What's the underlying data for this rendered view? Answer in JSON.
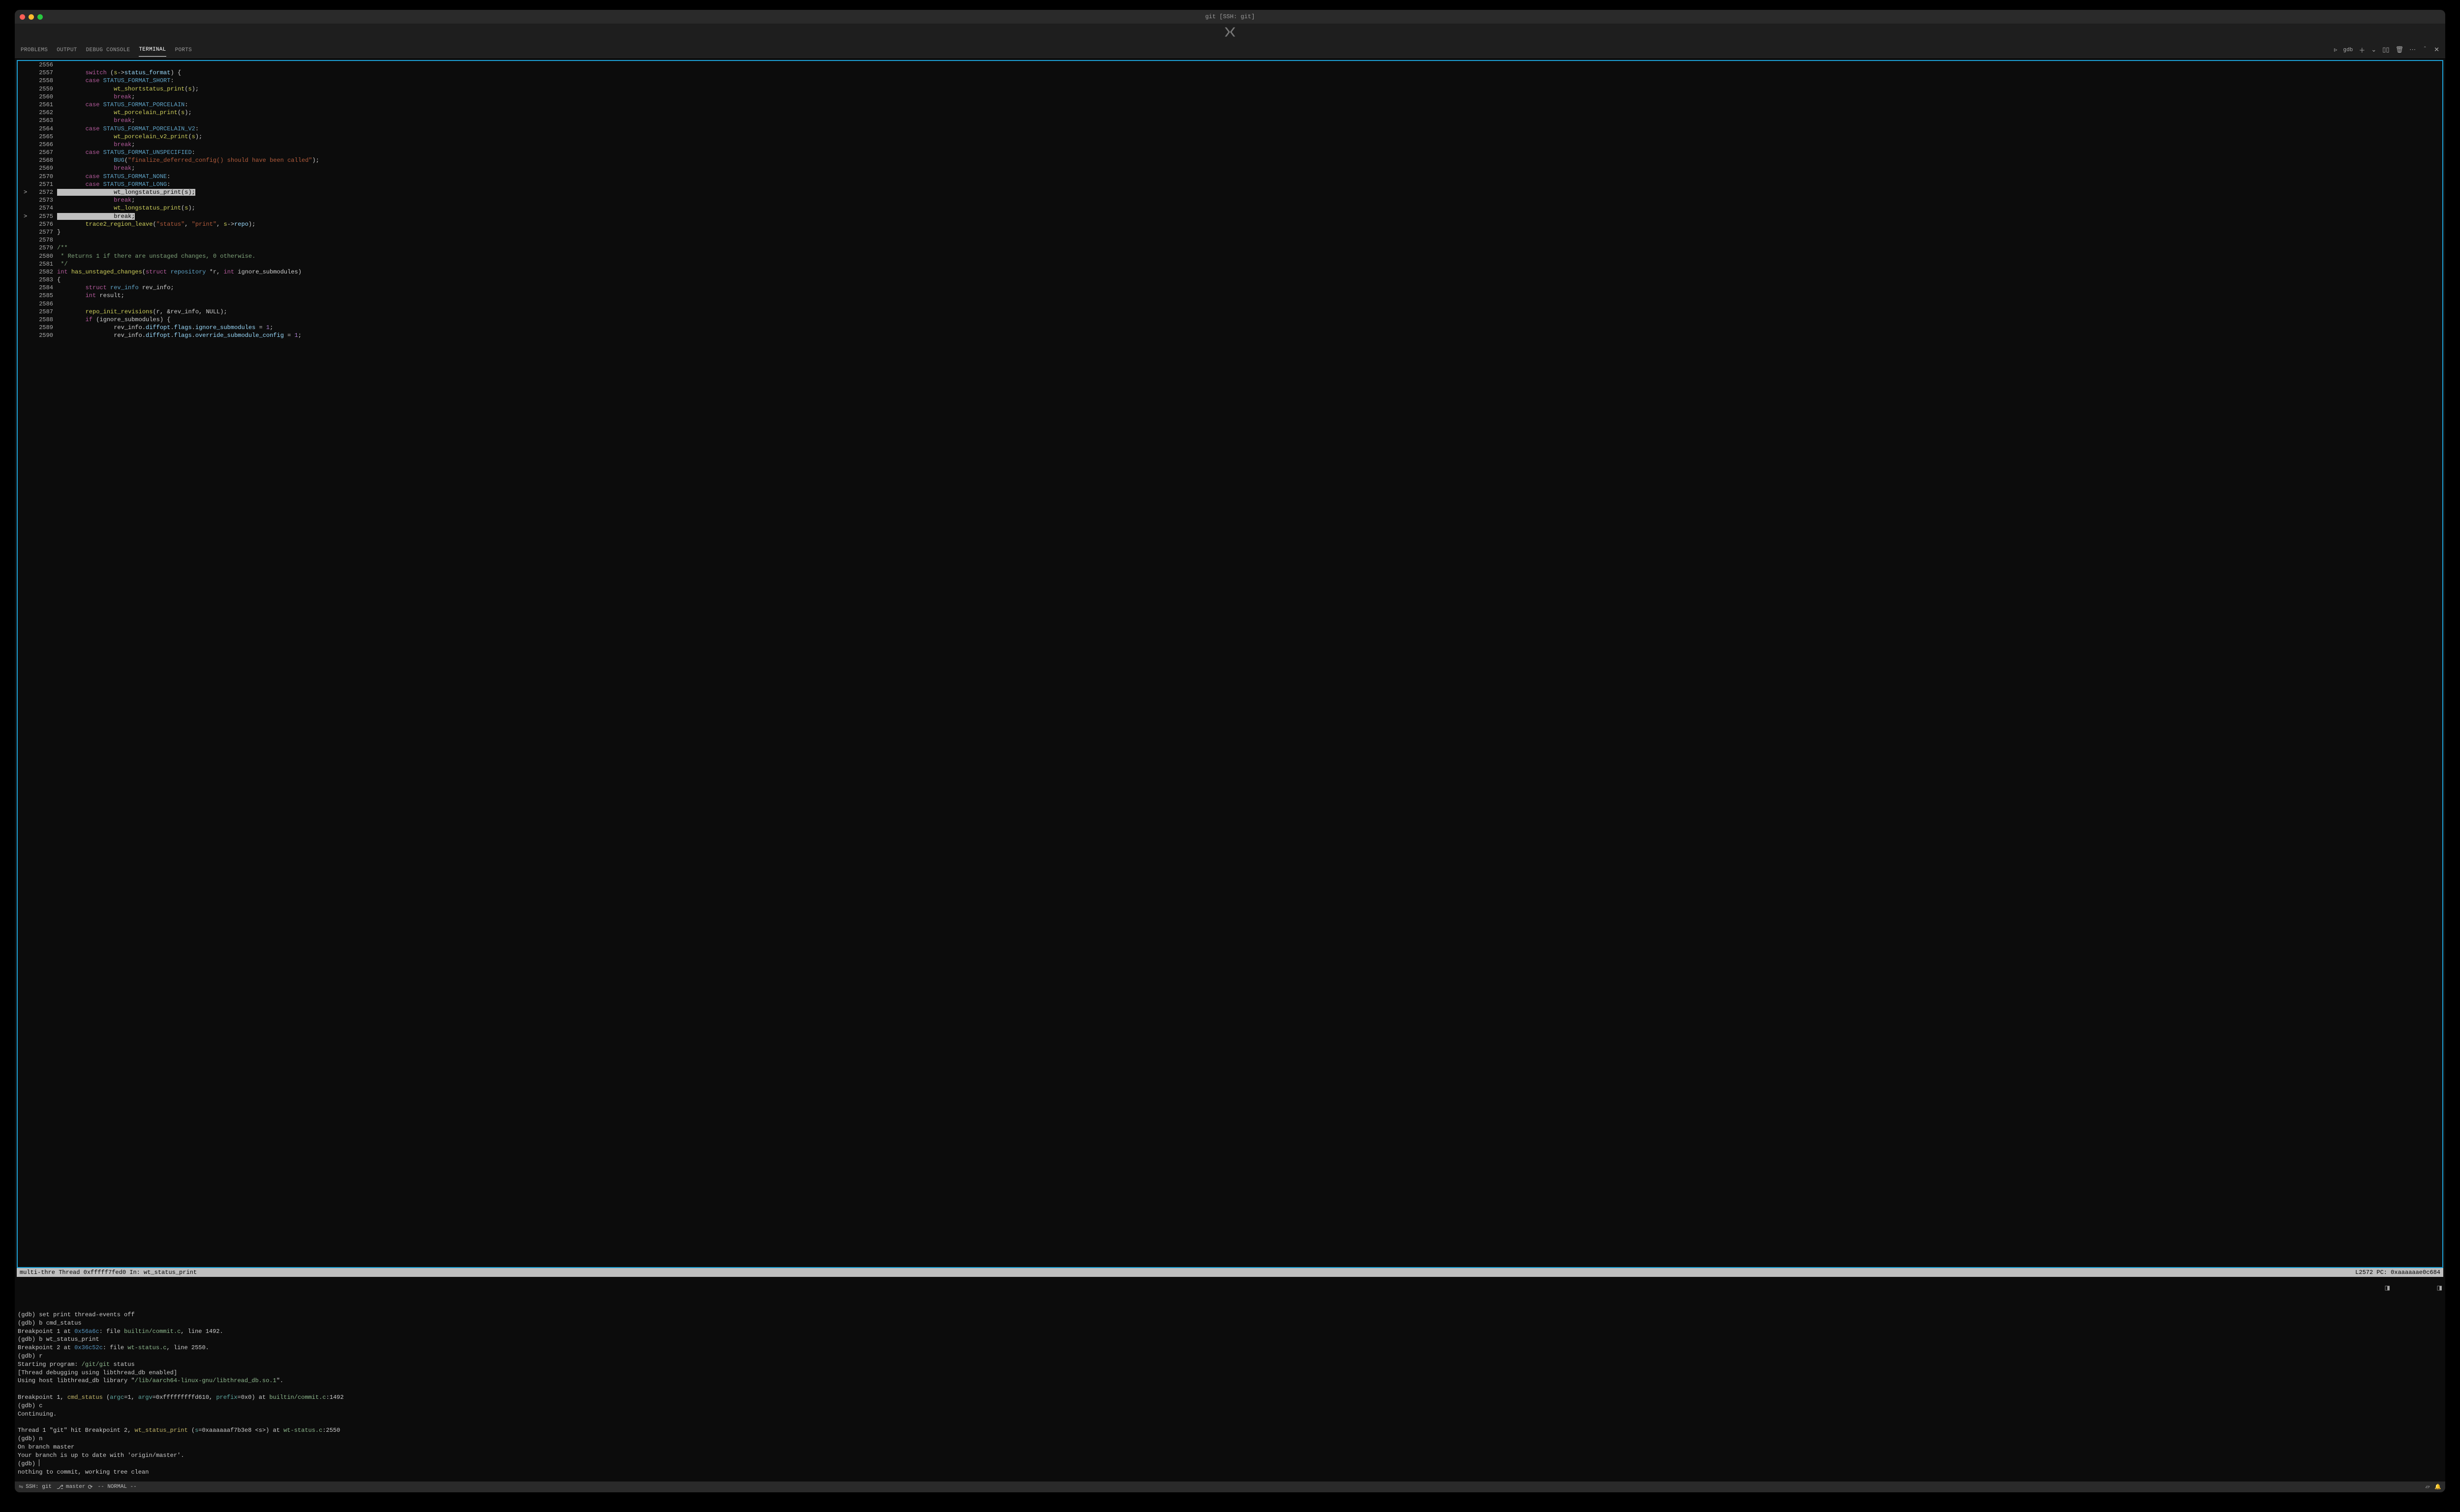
{
  "titlebar": {
    "title": "git [SSH: git]"
  },
  "panel": {
    "tabs": [
      {
        "label": "PROBLEMS",
        "active": false
      },
      {
        "label": "OUTPUT",
        "active": false
      },
      {
        "label": "DEBUG CONSOLE",
        "active": false
      },
      {
        "label": "TERMINAL",
        "active": true
      },
      {
        "label": "PORTS",
        "active": false
      }
    ],
    "right": {
      "profile_label": "gdb"
    }
  },
  "tui": {
    "status_left": "multi-thre Thread 0xfffff7fed0 In: wt_status_print",
    "status_right": "L2572 PC: 0xaaaaaae0c684"
  },
  "source": {
    "lines": [
      {
        "n": 2556,
        "mark": "",
        "segs": []
      },
      {
        "n": 2557,
        "mark": " ",
        "segs": [
          {
            "t": "        ",
            "c": ""
          },
          {
            "t": "switch",
            "c": "kw1"
          },
          {
            "t": " (",
            "c": "op"
          },
          {
            "t": "s",
            "c": "id"
          },
          {
            "t": "->",
            "c": "op"
          },
          {
            "t": "status_format",
            "c": "member"
          },
          {
            "t": ") {",
            "c": "op"
          }
        ]
      },
      {
        "n": 2558,
        "mark": " ",
        "segs": [
          {
            "t": "        ",
            "c": ""
          },
          {
            "t": "case",
            "c": "kw1"
          },
          {
            "t": " STATUS_FORMAT_SHORT",
            "c": "macro"
          },
          {
            "t": ":",
            "c": "op"
          }
        ]
      },
      {
        "n": 2559,
        "mark": " ",
        "segs": [
          {
            "t": "                ",
            "c": ""
          },
          {
            "t": "wt_shortstatus_print",
            "c": "id"
          },
          {
            "t": "(",
            "c": "op"
          },
          {
            "t": "s",
            "c": "id"
          },
          {
            "t": ");",
            "c": "op"
          }
        ]
      },
      {
        "n": 2560,
        "mark": " ",
        "segs": [
          {
            "t": "                ",
            "c": ""
          },
          {
            "t": "break",
            "c": "kw1"
          },
          {
            "t": ";",
            "c": "op"
          }
        ]
      },
      {
        "n": 2561,
        "mark": " ",
        "segs": [
          {
            "t": "        ",
            "c": ""
          },
          {
            "t": "case",
            "c": "kw1"
          },
          {
            "t": " STATUS_FORMAT_PORCELAIN",
            "c": "macro"
          },
          {
            "t": ":",
            "c": "op"
          }
        ]
      },
      {
        "n": 2562,
        "mark": " ",
        "segs": [
          {
            "t": "                ",
            "c": ""
          },
          {
            "t": "wt_porcelain_print",
            "c": "id"
          },
          {
            "t": "(",
            "c": "op"
          },
          {
            "t": "s",
            "c": "id"
          },
          {
            "t": ");",
            "c": "op"
          }
        ]
      },
      {
        "n": 2563,
        "mark": " ",
        "segs": [
          {
            "t": "                ",
            "c": ""
          },
          {
            "t": "break",
            "c": "kw1"
          },
          {
            "t": ";",
            "c": "op"
          }
        ]
      },
      {
        "n": 2564,
        "mark": " ",
        "segs": [
          {
            "t": "        ",
            "c": ""
          },
          {
            "t": "case",
            "c": "kw1"
          },
          {
            "t": " STATUS_FORMAT_PORCELAIN_V2",
            "c": "macro"
          },
          {
            "t": ":",
            "c": "op"
          }
        ]
      },
      {
        "n": 2565,
        "mark": " ",
        "segs": [
          {
            "t": "                ",
            "c": ""
          },
          {
            "t": "wt_porcelain_v2_print",
            "c": "id"
          },
          {
            "t": "(",
            "c": "op"
          },
          {
            "t": "s",
            "c": "id"
          },
          {
            "t": ");",
            "c": "op"
          }
        ]
      },
      {
        "n": 2566,
        "mark": " ",
        "segs": [
          {
            "t": "                ",
            "c": ""
          },
          {
            "t": "break",
            "c": "kw1"
          },
          {
            "t": ";",
            "c": "op"
          }
        ]
      },
      {
        "n": 2567,
        "mark": " ",
        "segs": [
          {
            "t": "        ",
            "c": ""
          },
          {
            "t": "case",
            "c": "kw1"
          },
          {
            "t": " STATUS_FORMAT_UNSPECIFIED",
            "c": "macro"
          },
          {
            "t": ":",
            "c": "op"
          }
        ]
      },
      {
        "n": 2568,
        "mark": " ",
        "segs": [
          {
            "t": "                ",
            "c": ""
          },
          {
            "t": "BUG",
            "c": "macro"
          },
          {
            "t": "(",
            "c": "op"
          },
          {
            "t": "\"finalize_deferred_config() should have been called\"",
            "c": "str"
          },
          {
            "t": ");",
            "c": "op"
          }
        ]
      },
      {
        "n": 2569,
        "mark": " ",
        "segs": [
          {
            "t": "                ",
            "c": ""
          },
          {
            "t": "break",
            "c": "kw1"
          },
          {
            "t": ";",
            "c": "op"
          }
        ]
      },
      {
        "n": 2570,
        "mark": " ",
        "segs": [
          {
            "t": "        ",
            "c": ""
          },
          {
            "t": "case",
            "c": "kw1"
          },
          {
            "t": " STATUS_FORMAT_NONE",
            "c": "macro"
          },
          {
            "t": ":",
            "c": "op"
          }
        ]
      },
      {
        "n": 2571,
        "mark": " ",
        "segs": [
          {
            "t": "        ",
            "c": ""
          },
          {
            "t": "case",
            "c": "kw1"
          },
          {
            "t": " STATUS_FORMAT_LONG",
            "c": "macro"
          },
          {
            "t": ":",
            "c": "op"
          }
        ]
      },
      {
        "n": 2572,
        "mark": ">",
        "hl": true,
        "segs": [
          {
            "t": "                wt_longstatus_print",
            "c": "mk-highlight"
          },
          {
            "t": "(",
            "c": "mk-highlight"
          },
          {
            "t": "s",
            "c": "mk-highlight"
          },
          {
            "t": ");",
            "c": "mk-highlight"
          }
        ]
      },
      {
        "n": 2573,
        "mark": " ",
        "segs": [
          {
            "t": "                ",
            "c": ""
          },
          {
            "t": "break",
            "c": "kw1"
          },
          {
            "t": ";",
            "c": "op"
          }
        ]
      },
      {
        "n": 2574,
        "mark": " ",
        "segs": [
          {
            "t": "                ",
            "c": ""
          },
          {
            "t": "wt_longstatus_print",
            "c": "id"
          },
          {
            "t": "(",
            "c": "op"
          },
          {
            "t": "s",
            "c": "id"
          },
          {
            "t": ");",
            "c": "op"
          }
        ]
      },
      {
        "n": 2575,
        "mark": ">",
        "hl": true,
        "segs": [
          {
            "t": "                break;",
            "c": "mk-highlight"
          }
        ]
      },
      {
        "n": 2576,
        "mark": " ",
        "segs": [
          {
            "t": "        ",
            "c": ""
          },
          {
            "t": "trace2_region_leave",
            "c": "id"
          },
          {
            "t": "(",
            "c": "op"
          },
          {
            "t": "\"status\"",
            "c": "str"
          },
          {
            "t": ", ",
            "c": "op"
          },
          {
            "t": "\"print\"",
            "c": "str"
          },
          {
            "t": ", ",
            "c": "op"
          },
          {
            "t": "s",
            "c": "id"
          },
          {
            "t": "->",
            "c": "op"
          },
          {
            "t": "repo",
            "c": "member"
          },
          {
            "t": ");",
            "c": "op"
          }
        ]
      },
      {
        "n": 2577,
        "mark": " ",
        "segs": [
          {
            "t": "}",
            "c": "op"
          }
        ]
      },
      {
        "n": 2578,
        "mark": " ",
        "segs": []
      },
      {
        "n": 2579,
        "mark": " ",
        "segs": [
          {
            "t": "/**",
            "c": "com"
          }
        ]
      },
      {
        "n": 2580,
        "mark": " ",
        "segs": [
          {
            "t": " * Returns 1 if there are unstaged changes, 0 otherwise.",
            "c": "com"
          }
        ]
      },
      {
        "n": 2581,
        "mark": " ",
        "segs": [
          {
            "t": " */",
            "c": "com"
          }
        ]
      },
      {
        "n": 2582,
        "mark": " ",
        "segs": [
          {
            "t": "int",
            "c": "kw1"
          },
          {
            "t": " ",
            "c": ""
          },
          {
            "t": "has_unstaged_changes",
            "c": "id"
          },
          {
            "t": "(",
            "c": "op"
          },
          {
            "t": "struct",
            "c": "kw1"
          },
          {
            "t": " ",
            "c": ""
          },
          {
            "t": "repository",
            "c": "macro"
          },
          {
            "t": " *",
            "c": "op"
          },
          {
            "t": "r",
            "c": ""
          },
          {
            "t": ", ",
            "c": "op"
          },
          {
            "t": "int",
            "c": "kw1"
          },
          {
            "t": " ignore_submodules)",
            "c": "op"
          }
        ]
      },
      {
        "n": 2583,
        "mark": " ",
        "segs": [
          {
            "t": "{",
            "c": "op"
          }
        ]
      },
      {
        "n": 2584,
        "mark": " ",
        "segs": [
          {
            "t": "        ",
            "c": ""
          },
          {
            "t": "struct",
            "c": "kw1"
          },
          {
            "t": " ",
            "c": ""
          },
          {
            "t": "rev_info",
            "c": "macro"
          },
          {
            "t": " rev_info;",
            "c": "op"
          }
        ]
      },
      {
        "n": 2585,
        "mark": " ",
        "segs": [
          {
            "t": "        ",
            "c": ""
          },
          {
            "t": "int",
            "c": "kw1"
          },
          {
            "t": " result;",
            "c": "op"
          }
        ]
      },
      {
        "n": 2586,
        "mark": " ",
        "segs": []
      },
      {
        "n": 2587,
        "mark": " ",
        "segs": [
          {
            "t": "        ",
            "c": ""
          },
          {
            "t": "repo_init_revisions",
            "c": "id"
          },
          {
            "t": "(r, &rev_info, NULL);",
            "c": "op"
          }
        ]
      },
      {
        "n": 2588,
        "mark": " ",
        "segs": [
          {
            "t": "        ",
            "c": ""
          },
          {
            "t": "if",
            "c": "kw1"
          },
          {
            "t": " (ignore_submodules) {",
            "c": "op"
          }
        ]
      },
      {
        "n": 2589,
        "mark": " ",
        "segs": [
          {
            "t": "                rev_info.",
            "c": "op"
          },
          {
            "t": "diffopt",
            "c": "member"
          },
          {
            "t": ".",
            "c": "op"
          },
          {
            "t": "flags",
            "c": "member"
          },
          {
            "t": ".",
            "c": "op"
          },
          {
            "t": "ignore_submodules",
            "c": "member"
          },
          {
            "t": " = ",
            "c": "op"
          },
          {
            "t": "1",
            "c": "num"
          },
          {
            "t": ";",
            "c": "op"
          }
        ]
      },
      {
        "n": 2590,
        "mark": " ",
        "segs": [
          {
            "t": "                rev_info.",
            "c": "op"
          },
          {
            "t": "diffopt",
            "c": "member"
          },
          {
            "t": ".",
            "c": "op"
          },
          {
            "t": "flags",
            "c": "member"
          },
          {
            "t": ".",
            "c": "op"
          },
          {
            "t": "override_submodule_config",
            "c": "member"
          },
          {
            "t": " = ",
            "c": "op"
          },
          {
            "t": "1",
            "c": "num"
          },
          {
            "t": ";",
            "c": "op"
          }
        ]
      }
    ]
  },
  "gdb": {
    "lines": [
      [
        {
          "t": "(gdb) set print thread-events off"
        }
      ],
      [
        {
          "t": "(gdb) b cmd_status"
        }
      ],
      [
        {
          "t": "Breakpoint 1 at "
        },
        {
          "t": "0x56a6c",
          "c": "blue"
        },
        {
          "t": ": file "
        },
        {
          "t": "builtin/commit.c",
          "c": "green"
        },
        {
          "t": ", line 1492."
        }
      ],
      [
        {
          "t": "(gdb) b wt_status_print"
        }
      ],
      [
        {
          "t": "Breakpoint 2 at "
        },
        {
          "t": "0x36c52c",
          "c": "blue"
        },
        {
          "t": ": file "
        },
        {
          "t": "wt-status.c",
          "c": "green"
        },
        {
          "t": ", line 2550."
        }
      ],
      [
        {
          "t": "(gdb) r"
        }
      ],
      [
        {
          "t": "Starting program: "
        },
        {
          "t": "/git/git",
          "c": "green"
        },
        {
          "t": " status"
        }
      ],
      [
        {
          "t": "[Thread debugging using libthread_db enabled]"
        }
      ],
      [
        {
          "t": "Using host libthread_db library \""
        },
        {
          "t": "/lib/aarch64-linux-gnu/libthread_db.so.1",
          "c": "green"
        },
        {
          "t": "\"."
        }
      ],
      [
        {
          "t": ""
        }
      ],
      [
        {
          "t": "Breakpoint 1, "
        },
        {
          "t": "cmd_status",
          "c": "yellow"
        },
        {
          "t": " ("
        },
        {
          "t": "argc",
          "c": "teal"
        },
        {
          "t": "=1, "
        },
        {
          "t": "argv",
          "c": "teal"
        },
        {
          "t": "=0xfffffffffd610, "
        },
        {
          "t": "prefix",
          "c": "teal"
        },
        {
          "t": "=0x0) at "
        },
        {
          "t": "builtin/commit.c",
          "c": "green"
        },
        {
          "t": ":1492"
        }
      ],
      [
        {
          "t": "(gdb) c"
        }
      ],
      [
        {
          "t": "Continuing."
        }
      ],
      [
        {
          "t": ""
        }
      ],
      [
        {
          "t": "Thread 1 \"git\" hit Breakpoint 2, "
        },
        {
          "t": "wt_status_print",
          "c": "yellow"
        },
        {
          "t": " ("
        },
        {
          "t": "s",
          "c": "teal"
        },
        {
          "t": "=0xaaaaaaf7b3e8 <s>) at "
        },
        {
          "t": "wt-status.c",
          "c": "green"
        },
        {
          "t": ":2550"
        }
      ],
      [
        {
          "t": "(gdb) n"
        }
      ],
      [
        {
          "t": "On branch master"
        }
      ],
      [
        {
          "t": "Your branch is up to date with 'origin/master'."
        }
      ],
      [
        {
          "t": "(gdb) "
        },
        {
          "t": "",
          "cursor": true
        }
      ],
      [
        {
          "t": "nothing to commit, working tree clean"
        }
      ]
    ],
    "side_indicators": [
      {
        "line_index": 2,
        "char": "◨"
      },
      {
        "line_index": 2,
        "char2": "◨"
      }
    ]
  },
  "statusbar": {
    "ssh": "SSH: git",
    "branch": "master",
    "vim_mode": "-- NORMAL --"
  }
}
